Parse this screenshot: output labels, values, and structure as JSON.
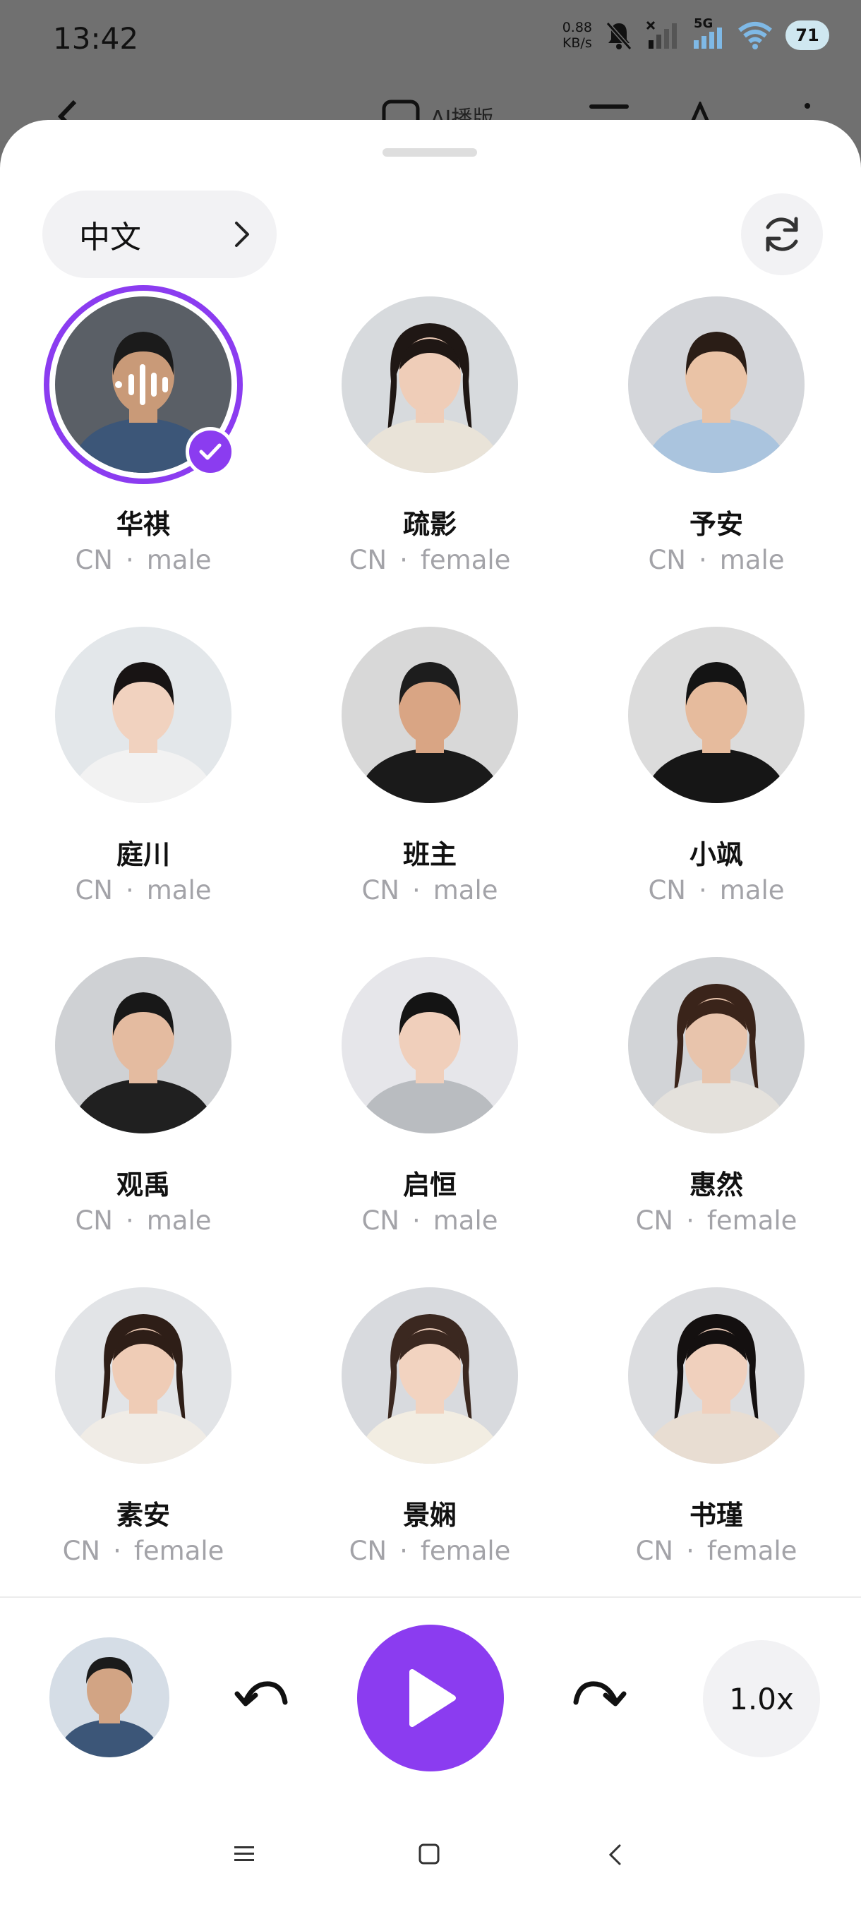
{
  "status_bar": {
    "time": "13:42",
    "net_speed_value": "0.88",
    "net_speed_unit": "KB/s",
    "network_type": "5G",
    "battery": "71"
  },
  "background_header": {
    "title_fragment": "AI播版"
  },
  "language_selector": {
    "label": "中文"
  },
  "voices": [
    {
      "name": "华祺",
      "region": "CN",
      "gender": "male",
      "selected": true,
      "skin": "#c99a78",
      "hair": "#1b1b1b",
      "shirt": "#3c5678",
      "bg": "#5a5f66"
    },
    {
      "name": "疏影",
      "region": "CN",
      "gender": "female",
      "selected": false,
      "skin": "#efcdb8",
      "hair": "#1f1714",
      "shirt": "#e9e3d8",
      "bg": "#d7dadd"
    },
    {
      "name": "予安",
      "region": "CN",
      "gender": "male",
      "selected": false,
      "skin": "#eac3a6",
      "hair": "#2a1d16",
      "shirt": "#aac4de",
      "bg": "#d4d6da"
    },
    {
      "name": "庭川",
      "region": "CN",
      "gender": "male",
      "selected": false,
      "skin": "#f1d2bf",
      "hair": "#181414",
      "shirt": "#f2f2f2",
      "bg": "#e3e7ea"
    },
    {
      "name": "班主",
      "region": "CN",
      "gender": "male",
      "selected": false,
      "skin": "#d9a584",
      "hair": "#1d1d1d",
      "shirt": "#1a1a1a",
      "bg": "#d8d8d8"
    },
    {
      "name": "小飒",
      "region": "CN",
      "gender": "male",
      "selected": false,
      "skin": "#e6bb9d",
      "hair": "#141414",
      "shirt": "#161616",
      "bg": "#dcdcdc"
    },
    {
      "name": "观禹",
      "region": "CN",
      "gender": "male",
      "selected": false,
      "skin": "#e4bba0",
      "hair": "#181818",
      "shirt": "#202020",
      "bg": "#cfd1d4"
    },
    {
      "name": "启恒",
      "region": "CN",
      "gender": "male",
      "selected": false,
      "skin": "#f0cfbb",
      "hair": "#141414",
      "shirt": "#b9bcc0",
      "bg": "#e6e6ea"
    },
    {
      "name": "惠然",
      "region": "CN",
      "gender": "female",
      "selected": false,
      "skin": "#e8c4ac",
      "hair": "#3a241a",
      "shirt": "#e4e1dc",
      "bg": "#d2d4d7"
    },
    {
      "name": "素安",
      "region": "CN",
      "gender": "female",
      "selected": false,
      "skin": "#efccb6",
      "hair": "#2e1e17",
      "shirt": "#f0ece6",
      "bg": "#e2e4e7"
    },
    {
      "name": "景娴",
      "region": "CN",
      "gender": "female",
      "selected": false,
      "skin": "#f2d3c0",
      "hair": "#3b2820",
      "shirt": "#f2ede2",
      "bg": "#d8dade"
    },
    {
      "name": "书瑾",
      "region": "CN",
      "gender": "female",
      "selected": false,
      "skin": "#f0d0bd",
      "hair": "#141010",
      "shirt": "#e8ddd2",
      "bg": "#dcdde0"
    }
  ],
  "player": {
    "speed": "1.0x"
  },
  "colors": {
    "accent": "#8b3cf0",
    "sheet_bg": "#ffffff",
    "pill_bg": "#f2f2f4",
    "meta_text": "#a3a3a8"
  },
  "icons": {
    "language_chevron": "chevron-right-icon",
    "refresh": "refresh-icon",
    "rewind": "rewind-icon",
    "play": "play-icon",
    "forward": "forward-icon"
  }
}
